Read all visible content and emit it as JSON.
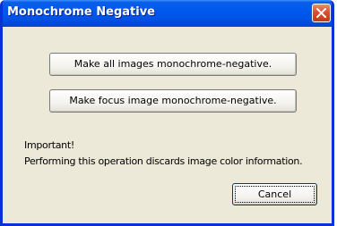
{
  "window": {
    "title": "Monochrome Negative",
    "close_icon": "close-icon"
  },
  "actions": {
    "all_images_label": "Make all images monochrome-negative.",
    "focus_image_label": "Make focus image monochrome-negative."
  },
  "notice": {
    "heading": "Important!",
    "message": "Performing this operation discards image color information."
  },
  "footer": {
    "cancel_label": "Cancel"
  },
  "colors": {
    "titlebar": "#0058ee",
    "window_background": "#ece9d8",
    "close_button": "#d8502d"
  }
}
